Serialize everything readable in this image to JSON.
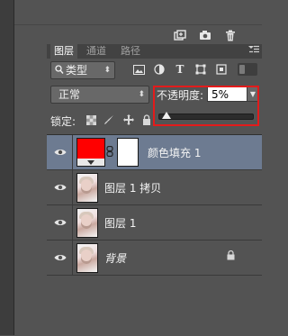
{
  "panel": {
    "tabs": [
      {
        "label": "图层"
      },
      {
        "label": "通道"
      },
      {
        "label": "路径"
      }
    ],
    "menu_icon": "menu-icon"
  },
  "top_icons": [
    "new-layer-icon",
    "camera-icon",
    "trash-icon"
  ],
  "filter": {
    "kind_label": "类型",
    "icons": [
      "image-filter-icon",
      "adjustment-filter-icon",
      "type-filter-icon",
      "shape-filter-icon",
      "smart-object-filter-icon"
    ]
  },
  "blend": {
    "mode": "正常",
    "opacity_label": "不透明度:",
    "opacity_value": "5%",
    "opacity_fraction": 0.05
  },
  "lock": {
    "label": "锁定:",
    "icons": [
      "lock-transparent-icon",
      "lock-image-icon",
      "lock-position-icon",
      "lock-all-icon"
    ]
  },
  "layers": [
    {
      "name": "颜色填充 1",
      "type": "fill",
      "selected": true,
      "visible": true
    },
    {
      "name": "图层 1 拷贝",
      "type": "image",
      "selected": false,
      "visible": true
    },
    {
      "name": "图层 1",
      "type": "image",
      "selected": false,
      "visible": true
    },
    {
      "name": "背景",
      "type": "background",
      "selected": false,
      "visible": true,
      "locked": true
    }
  ],
  "colors": {
    "fill_color": "#ff0000",
    "selected_row": "#6d7b91",
    "highlight_box": "#e31b1b"
  }
}
